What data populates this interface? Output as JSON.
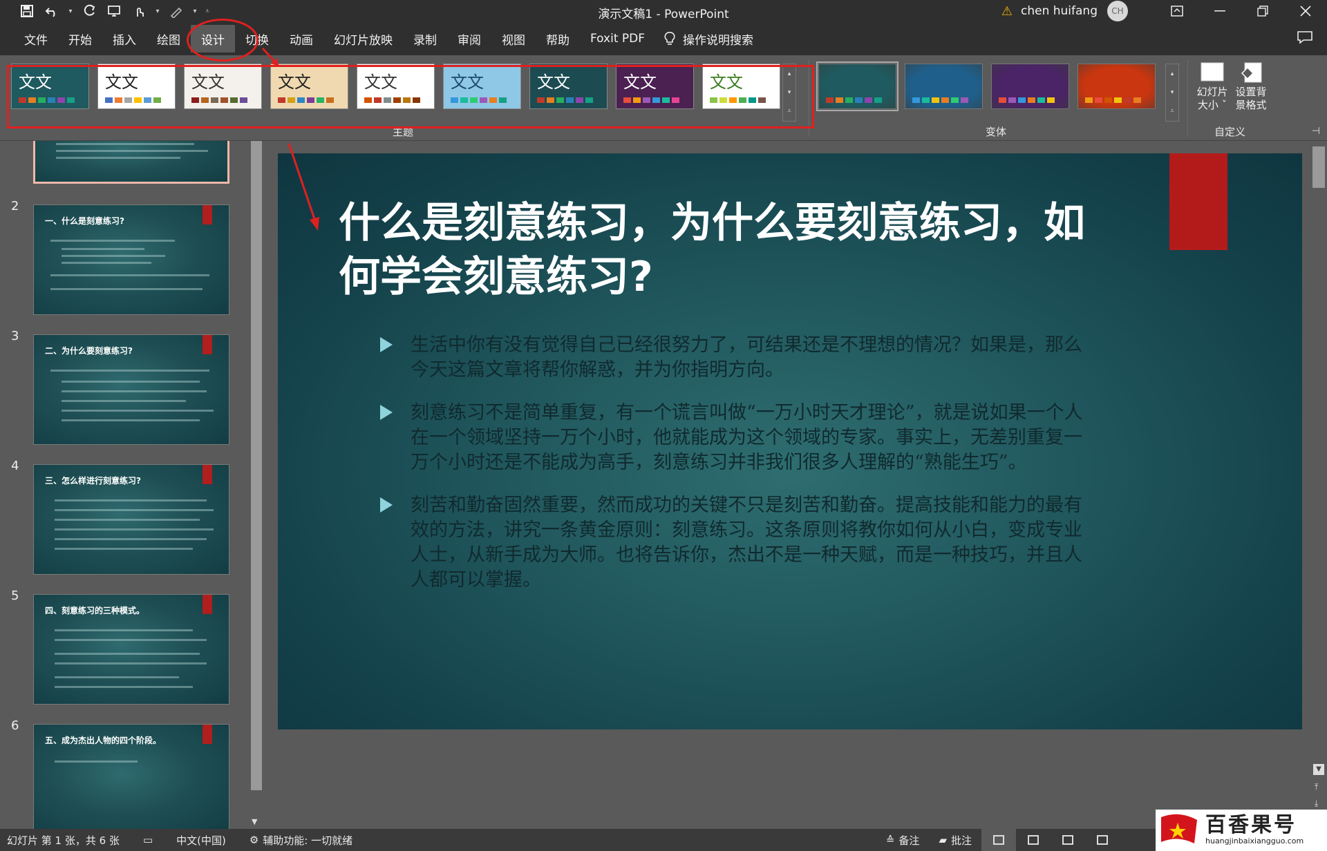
{
  "window": {
    "title": "演示文稿1  -  PowerPoint",
    "user": "chen huifang",
    "avatar_initials": "CH"
  },
  "tabs": [
    {
      "label": "文件"
    },
    {
      "label": "开始"
    },
    {
      "label": "插入"
    },
    {
      "label": "绘图"
    },
    {
      "label": "设计",
      "active": true
    },
    {
      "label": "切换"
    },
    {
      "label": "动画"
    },
    {
      "label": "幻灯片放映"
    },
    {
      "label": "录制"
    },
    {
      "label": "审阅"
    },
    {
      "label": "视图"
    },
    {
      "label": "帮助"
    },
    {
      "label": "Foxit PDF"
    }
  ],
  "tell_me": "操作说明搜索",
  "ribbon": {
    "themes_label": "主题",
    "variants_label": "变体",
    "custom_label": "自定义",
    "slide_size_label_1": "幻灯片",
    "slide_size_label_2": "大小 ˇ",
    "format_bg_label_1": "设置背",
    "format_bg_label_2": "景格式",
    "themes": [
      {
        "text": "文文",
        "bg": "#1e5a5f",
        "fg": "#ffffff",
        "swatches": [
          "#c0392b",
          "#e67e22",
          "#27ae60",
          "#2980b9",
          "#8e44ad",
          "#16a085"
        ]
      },
      {
        "text": "文文",
        "bg": "#ffffff",
        "fg": "#222222",
        "swatches": [
          "#4472c4",
          "#ed7d31",
          "#a5a5a5",
          "#ffc000",
          "#5b9bd5",
          "#70ad47"
        ]
      },
      {
        "text": "文文",
        "bg": "#f4f1ec",
        "fg": "#333333",
        "swatches": [
          "#8b1e1e",
          "#b5651d",
          "#7a6a53",
          "#a0522d",
          "#556b2f",
          "#6b4c9a"
        ]
      },
      {
        "text": "文文",
        "bg": "#f0d9b0",
        "fg": "#222222",
        "swatches": [
          "#c0392b",
          "#d4a017",
          "#2e86c1",
          "#7d3c98",
          "#28b463",
          "#ca6f1e"
        ]
      },
      {
        "text": "文文",
        "bg": "#ffffff",
        "fg": "#333333",
        "swatches": [
          "#d35400",
          "#c0392b",
          "#7f8c8d",
          "#a04000",
          "#b9770e",
          "#873600"
        ]
      },
      {
        "text": "文文",
        "bg": "#8fc7e6",
        "fg": "#1a4a6a",
        "swatches": [
          "#3498db",
          "#1abc9c",
          "#2ecc71",
          "#9b59b6",
          "#e67e22",
          "#16a085"
        ]
      },
      {
        "text": "文文",
        "bg": "#1c4c52",
        "fg": "#ffffff",
        "swatches": [
          "#c0392b",
          "#e67e22",
          "#27ae60",
          "#2980b9",
          "#8e44ad",
          "#16a085"
        ]
      },
      {
        "text": "文文",
        "bg": "#4a2151",
        "fg": "#ffffff",
        "swatches": [
          "#e74c3c",
          "#f39c12",
          "#9b59b6",
          "#3498db",
          "#1abc9c",
          "#e84393"
        ]
      },
      {
        "text": "文文",
        "bg": "#ffffff",
        "fg": "#3a7d1e",
        "swatches": [
          "#8bc34a",
          "#cddc39",
          "#ff9800",
          "#4caf50",
          "#009688",
          "#795548"
        ]
      }
    ],
    "variants": [
      {
        "bg": "#1e5a5f",
        "swatches": [
          "#c0392b",
          "#e67e22",
          "#27ae60",
          "#2980b9",
          "#8e44ad",
          "#16a085"
        ]
      },
      {
        "bg": "#1f5f8b",
        "swatches": [
          "#3498db",
          "#1abc9c",
          "#f1c40f",
          "#e67e22",
          "#2ecc71",
          "#9b59b6"
        ]
      },
      {
        "bg": "#4a2466",
        "swatches": [
          "#e74c3c",
          "#9b59b6",
          "#3498db",
          "#e67e22",
          "#1abc9c",
          "#f1c40f"
        ]
      },
      {
        "bg": "#c9360f",
        "swatches": [
          "#f39c12",
          "#e74c3c",
          "#d35400",
          "#f1c40f",
          "#c0392b",
          "#e67e22"
        ]
      }
    ]
  },
  "thumbnails": [
    {
      "num": "",
      "title": ""
    },
    {
      "num": "2",
      "title": "一、什么是刻意练习?"
    },
    {
      "num": "3",
      "title": "二、为什么要刻意练习?"
    },
    {
      "num": "4",
      "title": "三、怎么样进行刻意练习?"
    },
    {
      "num": "5",
      "title": "四、刻意练习的三种模式。"
    },
    {
      "num": "6",
      "title": "五、成为杰出人物的四个阶段。"
    }
  ],
  "slide": {
    "title": "什么是刻意练习，为什么要刻意练习，如何学会刻意练习?",
    "bullets": [
      "生活中你有没有觉得自己已经很努力了，可结果还是不理想的情况？如果是，那么今天这篇文章将帮你解惑，并为你指明方向。",
      "刻意练习不是简单重复，有一个谎言叫做“一万小时天才理论”，就是说如果一个人在一个领域坚持一万个小时，他就能成为这个领域的专家。事实上，无差别重复一万个小时还是不能成为高手，刻意练习并非我们很多人理解的“熟能生巧”。",
      "刻苦和勤奋固然重要，然而成功的关键不只是刻苦和勤奋。提高技能和能力的最有效的方法，讲究一条黄金原则：刻意练习。这条原则将教你如何从小白，变成专业人士，从新手成为大师。也将告诉你，杰出不是一种天赋，而是一种技巧，并且人人都可以掌握。"
    ]
  },
  "status": {
    "slide_info": "幻灯片 第 1 张，共 6 张",
    "language": "中文(中国)",
    "accessibility": "辅助功能: 一切就绪",
    "notes": "备注",
    "comments": "批注"
  },
  "watermark": {
    "name": "百香果号",
    "url": "huangjinbaixiangguo.com"
  },
  "colors": {
    "annotation_red": "#e0201f",
    "accent_tag": "#b31b1b"
  }
}
